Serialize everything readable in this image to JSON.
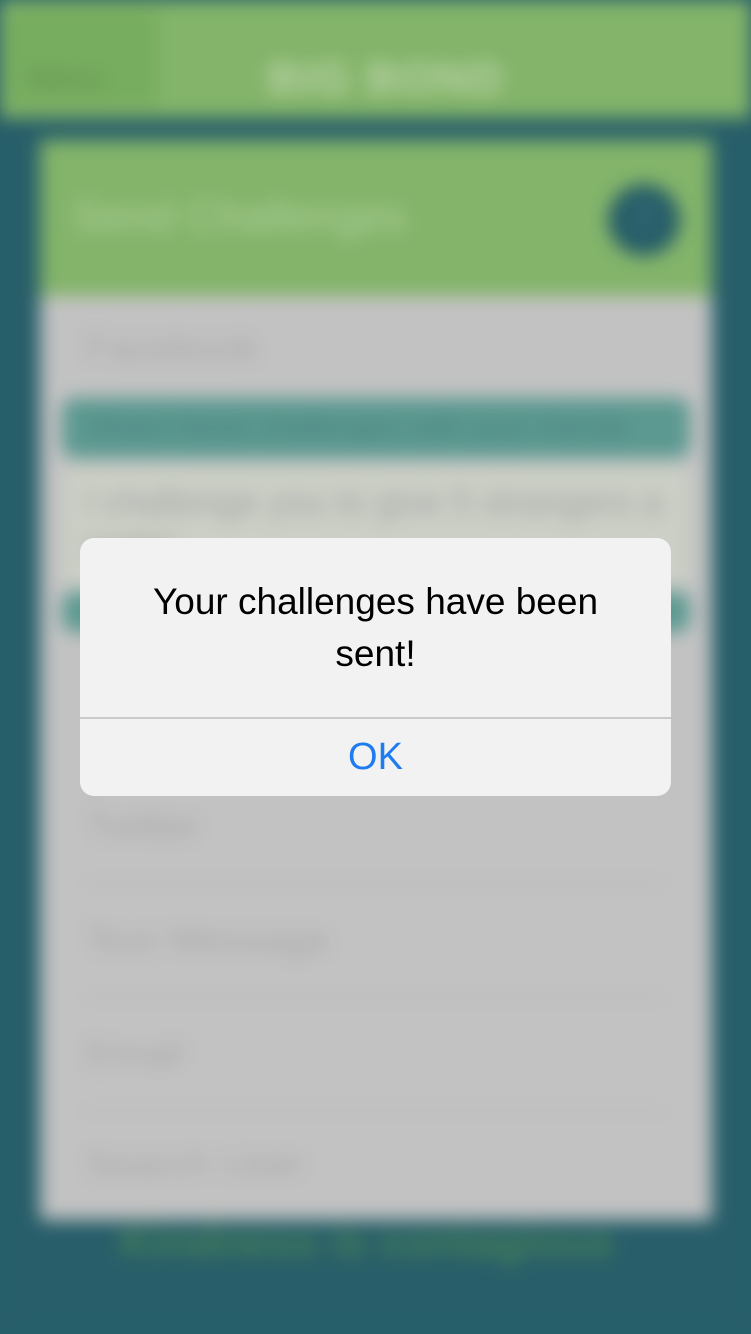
{
  "background": {
    "menu_label": "Menu",
    "app_logo": "BIG BOND",
    "card_title": "Send Challenges",
    "help_icon": "?",
    "options": [
      "Facebook",
      "Twitter",
      "Text Message",
      "Email",
      "Search User"
    ],
    "share_bar_text": "Share these challenges with your friends",
    "message_text": "I challenge you to give 5 strangers a smile!",
    "footer_tagline": "Kindness is contagious",
    "colors": {
      "teal": "#2a6470",
      "green": "#8cc071",
      "card_gray": "#cfcfcf"
    }
  },
  "alert": {
    "message": "Your challenges have been sent!",
    "ok_label": "OK",
    "accent_color": "#1f7cf0"
  }
}
